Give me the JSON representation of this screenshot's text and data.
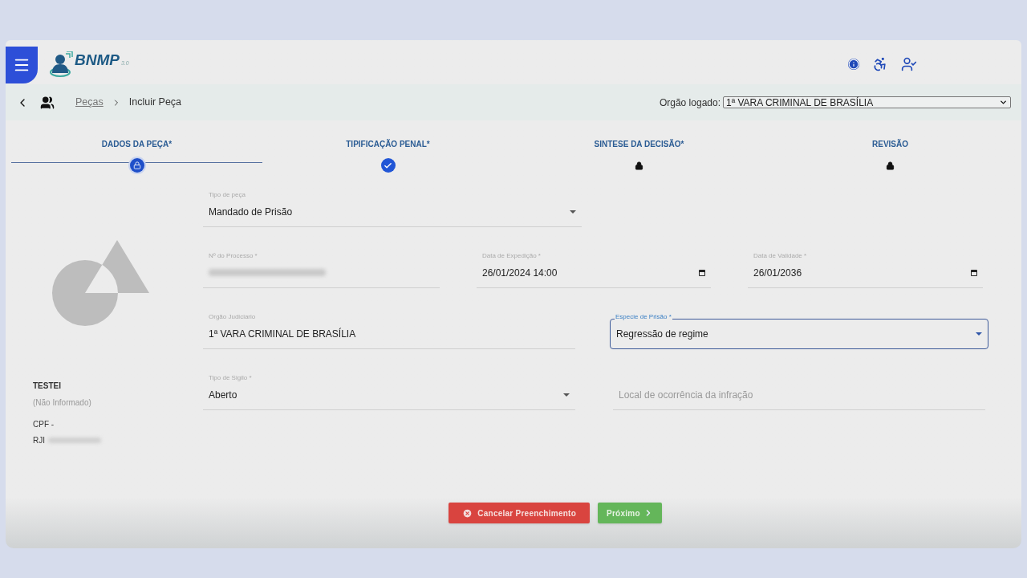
{
  "header": {
    "logo": {
      "name": "BNMP",
      "version": "3.0"
    }
  },
  "breadcrumb": {
    "items": [
      {
        "label": "Peças",
        "link": true
      },
      {
        "label": "Incluir Peça",
        "link": false
      }
    ]
  },
  "orgao": {
    "label": "Orgão logado:",
    "value": "1ª VARA CRIMINAL DE BRASÍLIA"
  },
  "steps": [
    {
      "label": "DADOS DA PEÇA*",
      "selected": true,
      "kind": "current"
    },
    {
      "label": "TIPIFICAÇÃO PENAL*",
      "selected": false,
      "kind": "done"
    },
    {
      "label": "SINTESE DA DECISÃO*",
      "selected": false,
      "kind": "locked"
    },
    {
      "label": "REVISÃO",
      "selected": false,
      "kind": "locked"
    }
  ],
  "person": {
    "name": "TESTEI",
    "subtitle": "(Não Informado)",
    "cpf": "CPF -",
    "rji_label": "RJI",
    "rji_redacted": true
  },
  "form_rows": [
    [
      {
        "kind": "select",
        "label": "Tipo de peça",
        "value": "Mandado de Prisão",
        "focused": false
      }
    ],
    [
      {
        "kind": "text",
        "label": "Nº do Processo *",
        "redacted": true,
        "focused": false
      },
      {
        "kind": "date",
        "label": "Data de Expedição *",
        "value": "26/01/2024 14:00",
        "focused": false
      },
      {
        "kind": "date",
        "label": "Data de Validade *",
        "value": "26/01/2036",
        "focused": false
      }
    ],
    [
      {
        "kind": "text",
        "label": "Orgão Judiciario",
        "value": "1ª VARA CRIMINAL DE BRASÍLIA",
        "focused": false
      },
      {
        "kind": "select",
        "label": "Especie de Prisão *",
        "value": "Regressão de regime",
        "focused": true
      }
    ],
    [
      {
        "kind": "select",
        "label": "Tipo de Sigilo *",
        "value": "Aberto",
        "focused": false
      },
      {
        "kind": "text",
        "placeholder": "Local de ocorrência da infração",
        "focused": false
      }
    ]
  ],
  "buttons": [
    {
      "kind": "cancel",
      "label": "Cancelar Preenchimento"
    },
    {
      "kind": "next",
      "label": "Próximo"
    }
  ]
}
